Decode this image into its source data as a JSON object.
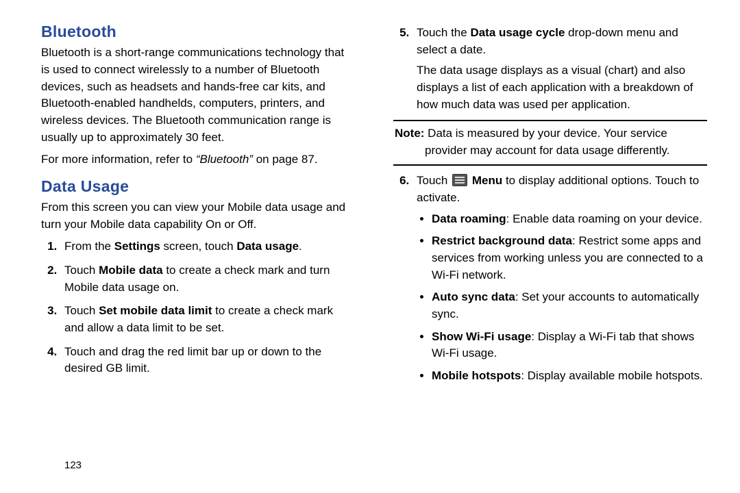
{
  "page_number": "123",
  "sections": {
    "bluetooth": {
      "heading": "Bluetooth",
      "body": "Bluetooth is a short-range communications technology that is used to connect wirelessly to a number of Bluetooth devices, such as headsets and hands-free car kits, and Bluetooth-enabled handhelds, computers, printers, and wireless devices. The Bluetooth communication range is usually up to approximately 30 feet.",
      "ref_prefix": "For more information, refer to ",
      "ref_italic": "“Bluetooth”",
      "ref_suffix": " on page 87."
    },
    "data_usage": {
      "heading": "Data Usage",
      "intro": "From this screen you can view your Mobile data usage and turn your Mobile data capability On or Off.",
      "step1_pre": "From the ",
      "step1_b1": "Settings",
      "step1_mid": " screen, touch ",
      "step1_b2": "Data usage",
      "step1_post": ".",
      "step2_pre": "Touch ",
      "step2_b": "Mobile data",
      "step2_post": " to create a check mark and turn Mobile data usage on.",
      "step3_pre": "Touch ",
      "step3_b": "Set mobile data limit",
      "step3_post": " to create a check mark and allow a data limit to be set.",
      "step4": "Touch and drag the red limit bar up or down to the desired GB limit.",
      "step5_pre": "Touch the ",
      "step5_b": "Data usage cycle",
      "step5_post": " drop-down menu and select a date.",
      "step5_extra": "The data usage displays as a visual (chart) and also displays a list of each application with a breakdown of how much data was used per application.",
      "note_label": "Note:",
      "note_body": " Data is measured by your device. Your service provider may account for data usage differently.",
      "step6_pre": "Touch ",
      "step6_b": "Menu",
      "step6_post": " to display additional options. Touch to activate.",
      "bullets": {
        "b1t": "Data roaming",
        "b1d": ": Enable data roaming on your device.",
        "b2t": "Restrict background data",
        "b2d": ": Restrict some apps and services from working unless you are connected to a Wi-Fi network.",
        "b3t": "Auto sync data",
        "b3d": ": Set your accounts to automatically sync.",
        "b4t": "Show Wi-Fi usage",
        "b4d": ": Display a Wi-Fi tab that shows Wi-Fi usage.",
        "b5t": "Mobile hotspots",
        "b5d": ": Display available mobile hotspots."
      }
    }
  }
}
